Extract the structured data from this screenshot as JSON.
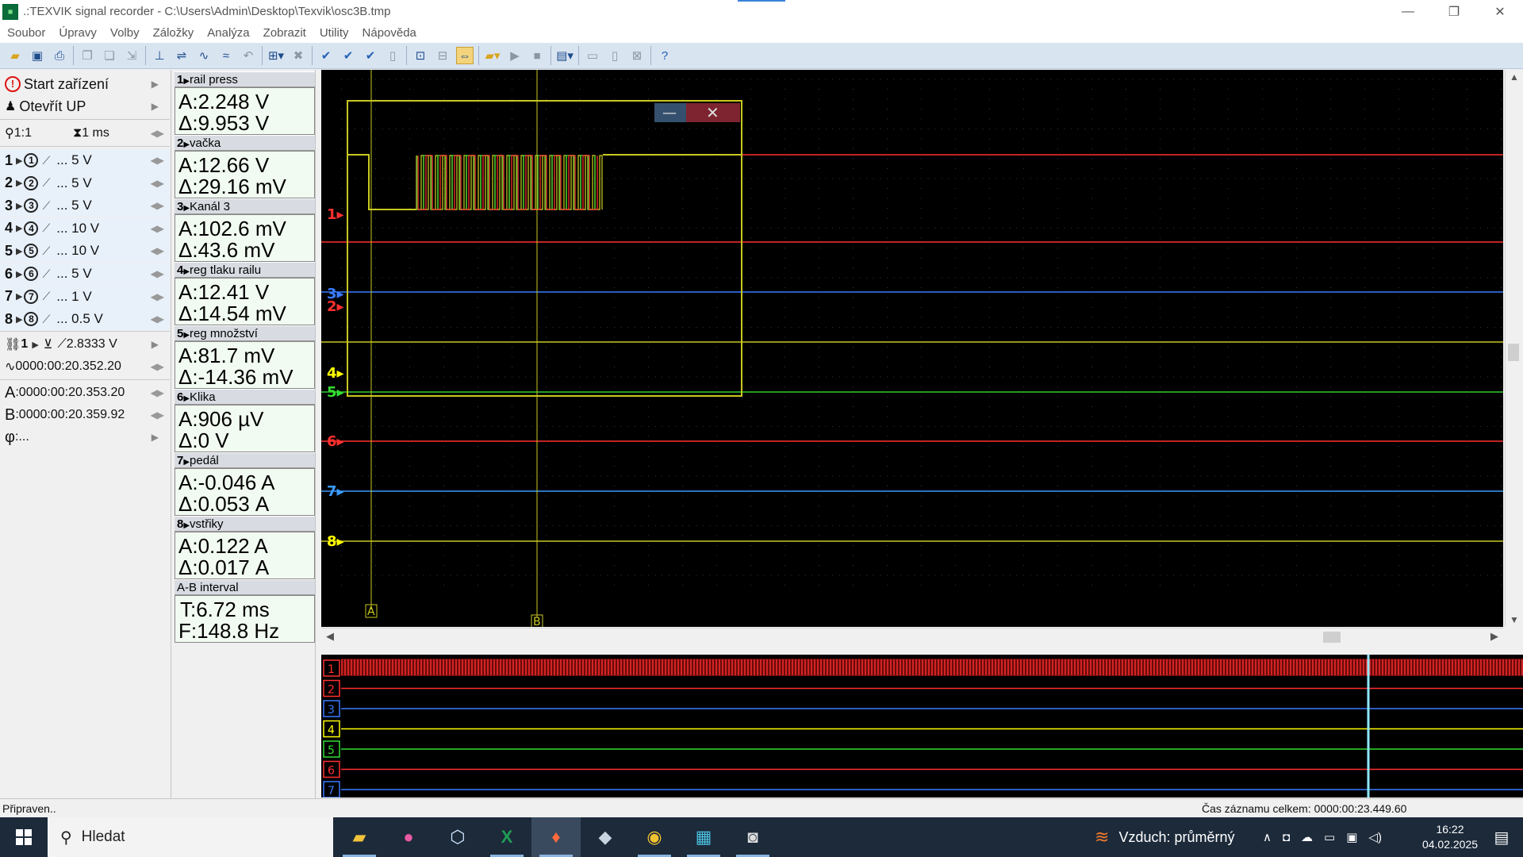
{
  "window": {
    "title": ".:TEXVIK  signal recorder - C:\\Users\\Admin\\Desktop\\Texvik\\osc3B.tmp",
    "minimize_glyph": "—",
    "restore_glyph": "❐",
    "close_glyph": "✕"
  },
  "menu": [
    "Soubor",
    "Úpravy",
    "Volby",
    "Záložky",
    "Analýza",
    "Zobrazit",
    "Utility",
    "Nápověda"
  ],
  "left_panel": {
    "start_label": "Start zařízení",
    "open_label": "Otevřít UP",
    "zoom_label": "1:1",
    "timebase_label": "1 ms",
    "channels": [
      {
        "num": "1",
        "range": "... 5 V"
      },
      {
        "num": "2",
        "range": "... 5 V"
      },
      {
        "num": "3",
        "range": "... 5 V"
      },
      {
        "num": "4",
        "range": "... 10 V"
      },
      {
        "num": "5",
        "range": "... 10 V"
      },
      {
        "num": "6",
        "range": "... 5 V"
      },
      {
        "num": "7",
        "range": "... 1 V"
      },
      {
        "num": "8",
        "range": "... 0.5 V"
      }
    ],
    "trigger_channel": "1",
    "trigger_level": "2.8333 V",
    "trigger_time": "0000:00:20.352.20",
    "cursor_a_label": "A",
    "cursor_a_time": "0000:00:20.353.20",
    "cursor_b_label": "B",
    "cursor_b_time": "0000:00:20.359.92",
    "phi_label": "φ",
    "phi_value": "..."
  },
  "measurements": [
    {
      "num": "1",
      "name": "rail press",
      "a": "A:2.248 V",
      "d": "Δ:9.953 V"
    },
    {
      "num": "2",
      "name": "vačka",
      "a": "A:12.66 V",
      "d": "Δ:29.16 mV"
    },
    {
      "num": "3",
      "name": "Kanál 3",
      "a": "A:102.6 mV",
      "d": "Δ:43.6 mV"
    },
    {
      "num": "4",
      "name": "reg tlaku railu",
      "a": "A:12.41 V",
      "d": "Δ:14.54 mV"
    },
    {
      "num": "5",
      "name": "reg množství",
      "a": "A:81.7 mV",
      "d": "Δ:-14.36 mV"
    },
    {
      "num": "6",
      "name": "Klika",
      "a": "A:906 µV",
      "d": "Δ:0 V"
    },
    {
      "num": "7",
      "name": "pedál",
      "a": "A:-0.046 A",
      "d": "Δ:0.053 A"
    },
    {
      "num": "8",
      "name": "vstřiky",
      "a": "A:0.122 A",
      "d": "Δ:0.017 A"
    }
  ],
  "interval": {
    "head": "A-B interval",
    "t": "T:6.72 ms",
    "f": "F:148.8 Hz"
  },
  "scope": {
    "channel_markers": [
      {
        "label": "1",
        "color": "#ff3030"
      },
      {
        "label": "3",
        "color": "#3a7bff"
      },
      {
        "label": "2",
        "color": "#ff3030"
      },
      {
        "label": "4",
        "color": "#ffff00"
      },
      {
        "label": "5",
        "color": "#33dd33"
      },
      {
        "label": "6",
        "color": "#ff3030"
      },
      {
        "label": "7",
        "color": "#3a9bff"
      },
      {
        "label": "8",
        "color": "#ffff00"
      }
    ],
    "cursor_a": "A",
    "cursor_b": "B"
  },
  "overview": {
    "channels": [
      {
        "label": "1",
        "color": "#ff3030"
      },
      {
        "label": "2",
        "color": "#ff3030"
      },
      {
        "label": "3",
        "color": "#3a7bff"
      },
      {
        "label": "4",
        "color": "#ffff00"
      },
      {
        "label": "5",
        "color": "#33dd33"
      },
      {
        "label": "6",
        "color": "#ff3030"
      },
      {
        "label": "7",
        "color": "#3a7bff"
      }
    ]
  },
  "status": {
    "left": "Připraven..",
    "right": "Čas záznamu celkem: 0000:00:23.449.60"
  },
  "taskbar": {
    "search_placeholder": "Hledat",
    "weather": "Vzduch: průměrný",
    "time": "16:22",
    "date": "04.02.2025"
  }
}
